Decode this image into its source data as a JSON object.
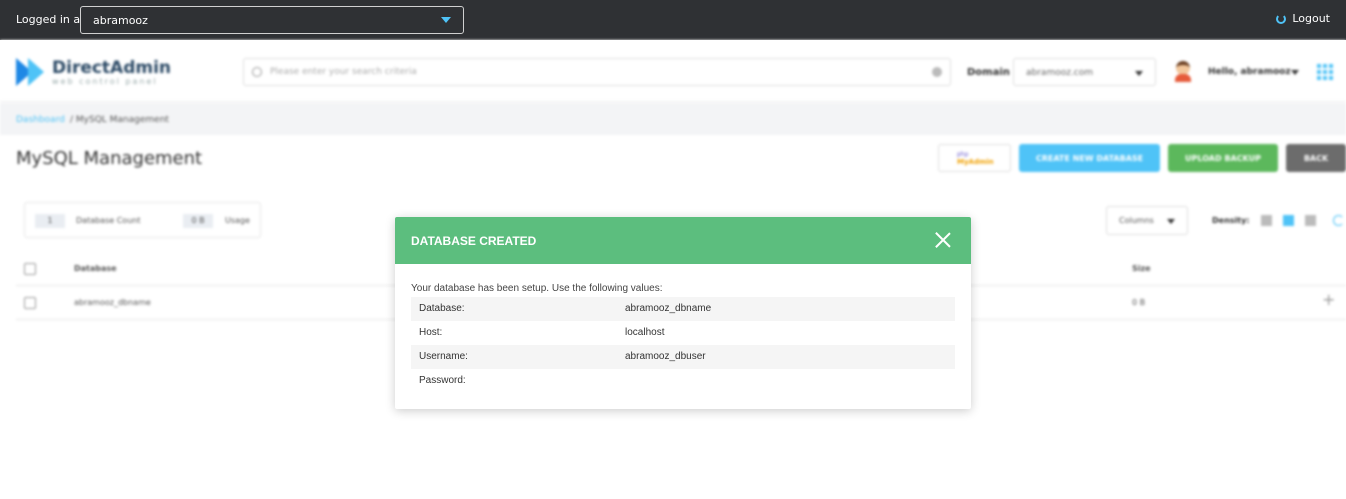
{
  "topbar": {
    "logged_in_label": "Logged in as",
    "user": "abramooz",
    "logout_label": "Logout"
  },
  "header": {
    "logo_name": "DirectAdmin",
    "logo_tagline": "web control panel",
    "search_placeholder": "Please enter your search criteria",
    "domain_label": "Domain",
    "domain_value": "abramooz.com",
    "hello": "Hello, abramooz"
  },
  "breadcrumb": {
    "dashboard": "Dashboard",
    "current": "/ MySQL Management"
  },
  "page": {
    "title": "MySQL Management",
    "pma_top": "php",
    "pma_bottom": "MyAdmin",
    "create_btn": "CREATE NEW DATABASE",
    "upload_btn": "UPLOAD BACKUP",
    "back_btn": "BACK"
  },
  "stats": {
    "db_count_value": "1",
    "db_count_label": "Database Count",
    "usage_value": "0 B",
    "usage_label": "Usage"
  },
  "toolbar": {
    "columns_label": "Columns",
    "density_label": "Density:"
  },
  "table": {
    "headers": {
      "database": "Database",
      "size": "Size"
    },
    "rows": [
      {
        "database": "abramooz_dbname",
        "size": "0 B"
      }
    ]
  },
  "modal": {
    "title": "DATABASE CREATED",
    "intro": "Your database has been setup. Use the following values:",
    "rows": [
      {
        "key": "Database:",
        "value": "abramooz_dbname"
      },
      {
        "key": "Host:",
        "value": "localhost"
      },
      {
        "key": "Username:",
        "value": "abramooz_dbuser"
      },
      {
        "key": "Password:",
        "value": ""
      }
    ]
  },
  "colors": {
    "accent": "#4fc3f7",
    "success": "#5cbe7e",
    "topbar": "#2f3134"
  }
}
